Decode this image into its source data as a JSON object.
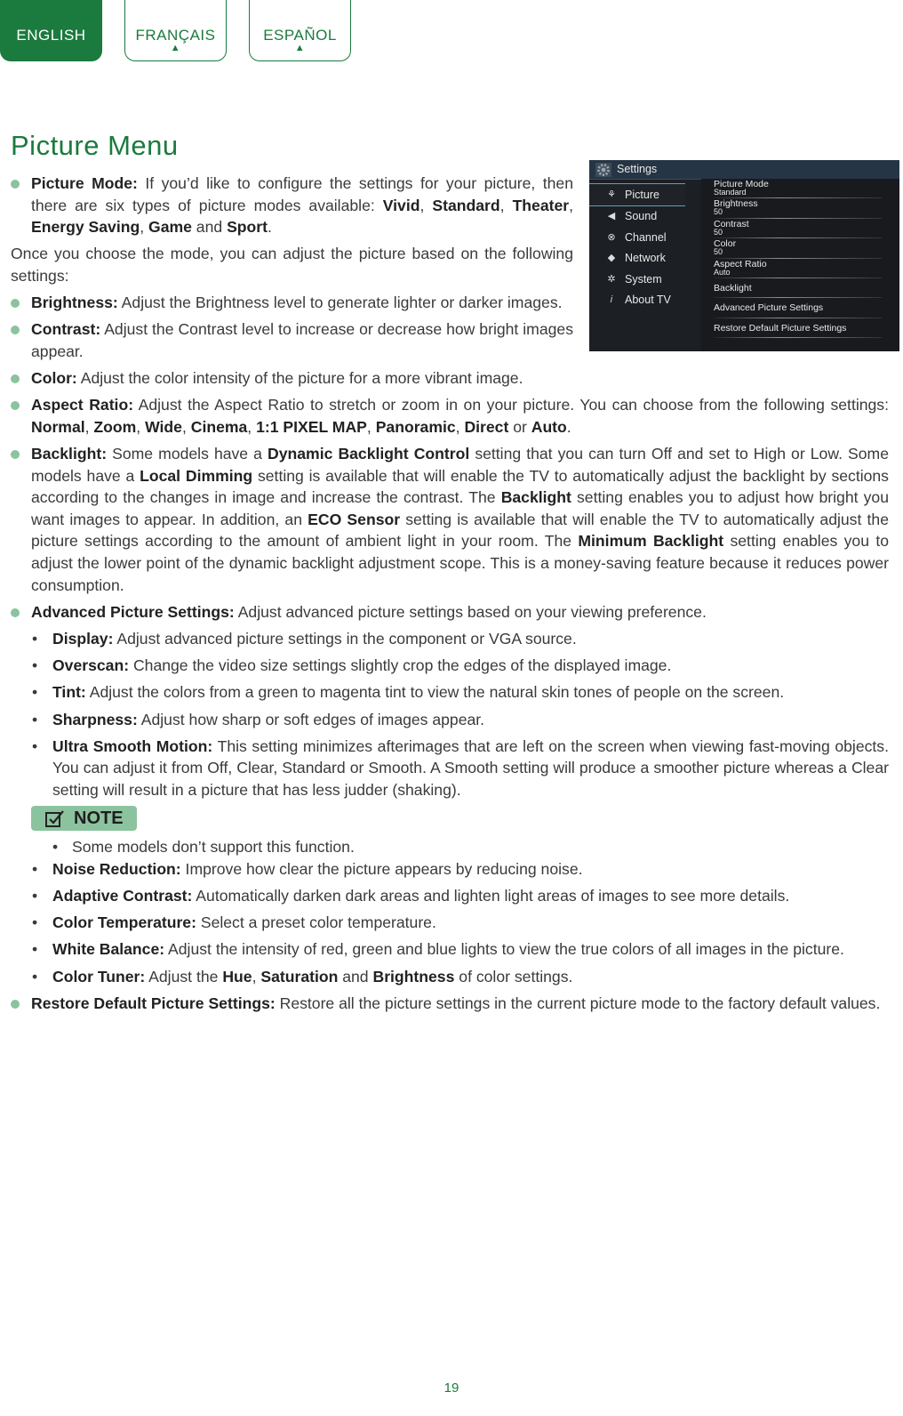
{
  "tabs": [
    {
      "label": "ENGLISH",
      "active": true
    },
    {
      "label": "FRANÇAIS",
      "marker": "▲"
    },
    {
      "label": "ESPAÑOL",
      "marker": "▲"
    }
  ],
  "title": "Picture Menu",
  "colors": {
    "brand": "#1b7a3e",
    "bullet": "#8cc39f",
    "note_bg": "#8cc39f"
  },
  "tv_screen": {
    "header": "Settings",
    "header_icon": "gear-icon",
    "menu": [
      {
        "label": "Picture",
        "icon": "picture-icon",
        "selected": true
      },
      {
        "label": "Sound",
        "icon": "speaker-icon"
      },
      {
        "label": "Channel",
        "icon": "satellite-icon"
      },
      {
        "label": "Network",
        "icon": "network-icon"
      },
      {
        "label": "System",
        "icon": "cog-icon"
      },
      {
        "label": "About TV",
        "icon": "info-icon"
      }
    ],
    "settings": [
      {
        "label": "Picture Mode",
        "value": "Standard"
      },
      {
        "label": "Brightness",
        "value": "50"
      },
      {
        "label": "Contrast",
        "value": "50"
      },
      {
        "label": "Color",
        "value": "50"
      },
      {
        "label": "Aspect Ratio",
        "value": "Auto"
      },
      {
        "label": "Backlight"
      },
      {
        "label": "Advanced Picture Settings"
      },
      {
        "label": "Restore Default Picture Settings"
      }
    ]
  },
  "paragraphs": [
    {
      "type": "circle",
      "segments": [
        [
          "Picture Mode:",
          1
        ],
        [
          " If you’d like to configure the settings for your picture, then there are six types of picture modes available: ",
          0
        ],
        [
          "Vivid",
          1
        ],
        [
          ", ",
          0
        ],
        [
          "Standard",
          1
        ],
        [
          ", ",
          0
        ],
        [
          "Theater",
          1
        ],
        [
          ", ",
          0
        ],
        [
          "Energy Saving",
          1
        ],
        [
          ", ",
          0
        ],
        [
          "Game",
          1
        ],
        [
          " and ",
          0
        ],
        [
          "Sport",
          1
        ],
        [
          ".",
          0
        ]
      ]
    },
    {
      "type": "plain",
      "segments": [
        [
          "Once you choose the mode, you can adjust the picture based on the following settings:",
          0
        ]
      ]
    },
    {
      "type": "circle",
      "segments": [
        [
          "Brightness:",
          1
        ],
        [
          " Adjust the Brightness level to generate lighter or darker images.",
          0
        ]
      ]
    },
    {
      "type": "circle",
      "segments": [
        [
          "Contrast:",
          1
        ],
        [
          " Adjust the Contrast level to increase or decrease how bright images appear.",
          0
        ]
      ]
    },
    {
      "type": "circle",
      "segments": [
        [
          "Color:",
          1
        ],
        [
          " Adjust the color intensity of the picture for a more vibrant image.",
          0
        ]
      ]
    },
    {
      "type": "circle",
      "segments": [
        [
          "Aspect Ratio:",
          1
        ],
        [
          " Adjust the Aspect Ratio to stretch or zoom in on your picture. You can choose from the following settings: ",
          0
        ],
        [
          "Normal",
          1
        ],
        [
          ", ",
          0
        ],
        [
          "Zoom",
          1
        ],
        [
          ", ",
          0
        ],
        [
          "Wide",
          1
        ],
        [
          ", ",
          0
        ],
        [
          "Cinema",
          1
        ],
        [
          ", ",
          0
        ],
        [
          "1:1 PIXEL MAP",
          1
        ],
        [
          ", ",
          0
        ],
        [
          "Panoramic",
          1
        ],
        [
          ", ",
          0
        ],
        [
          "Direct",
          1
        ],
        [
          " or ",
          0
        ],
        [
          "Auto",
          1
        ],
        [
          ".",
          0
        ]
      ]
    },
    {
      "type": "circle",
      "segments": [
        [
          "Backlight:",
          1
        ],
        [
          " Some models have a ",
          0
        ],
        [
          "Dynamic Backlight Control",
          1
        ],
        [
          " setting that you can turn Off and set to High or Low. Some models have a ",
          0
        ],
        [
          "Local Dimming",
          1
        ],
        [
          " setting is available that will enable the TV to automatically adjust the backlight by sections according to the changes in image and increase the contrast. The ",
          0
        ],
        [
          "Backlight",
          1
        ],
        [
          " setting enables you to adjust how bright you want images to appear. In addition, an ",
          0
        ],
        [
          "ECO Sensor",
          1
        ],
        [
          " setting is available that will enable the TV to automatically adjust the picture settings according to the amount of ambient light in your room. The ",
          0
        ],
        [
          "Minimum Backlight",
          1
        ],
        [
          " setting enables you to adjust the lower point of the dynamic backlight adjustment scope. This is a money-saving feature because it reduces power consumption.",
          0
        ]
      ]
    },
    {
      "type": "circle",
      "segments": [
        [
          "Advanced Picture Settings:",
          1
        ],
        [
          " Adjust advanced picture settings based on your viewing preference.",
          0
        ]
      ]
    },
    {
      "type": "dot",
      "segments": [
        [
          "Display:",
          1
        ],
        [
          " Adjust advanced picture settings in the component or VGA source.",
          0
        ]
      ]
    },
    {
      "type": "dot",
      "segments": [
        [
          "Overscan:",
          1
        ],
        [
          " Change the video size settings slightly crop the edges of the displayed image.",
          0
        ]
      ]
    },
    {
      "type": "dot",
      "segments": [
        [
          "Tint:",
          1
        ],
        [
          " Adjust the colors from a green to magenta tint to view the natural skin tones of people on the screen.",
          0
        ]
      ]
    },
    {
      "type": "dot",
      "segments": [
        [
          "Sharpness:",
          1
        ],
        [
          " Adjust how sharp or soft edges of images appear.",
          0
        ]
      ]
    },
    {
      "type": "dot",
      "segments": [
        [
          "Ultra Smooth Motion:",
          1
        ],
        [
          " This setting minimizes afterimages that are left on the screen when viewing fast-moving objects. You can adjust it from Off, Clear, Standard or Smooth. A Smooth setting will produce a smoother picture whereas a Clear setting will result in a picture that has less judder (shaking).",
          0
        ]
      ]
    },
    {
      "type": "note",
      "label": "NOTE"
    },
    {
      "type": "subdot",
      "segments": [
        [
          "Some models don’t support this function.",
          0
        ]
      ]
    },
    {
      "type": "dot",
      "segments": [
        [
          "Noise Reduction:",
          1
        ],
        [
          " Improve how clear the picture appears by reducing noise.",
          0
        ]
      ]
    },
    {
      "type": "dot",
      "segments": [
        [
          "Adaptive Contrast:",
          1
        ],
        [
          " Automatically darken dark areas and lighten light areas of images to see more details.",
          0
        ]
      ]
    },
    {
      "type": "dot",
      "segments": [
        [
          "Color Temperature:",
          1
        ],
        [
          " Select a preset color temperature.",
          0
        ]
      ]
    },
    {
      "type": "dot",
      "segments": [
        [
          "White Balance:",
          1
        ],
        [
          " Adjust the intensity of red, green and blue lights to view the true colors of all images in the picture.",
          0
        ]
      ]
    },
    {
      "type": "dot",
      "segments": [
        [
          "Color Tuner:",
          1
        ],
        [
          " Adjust the ",
          0
        ],
        [
          "Hue",
          1
        ],
        [
          ", ",
          0
        ],
        [
          "Saturation",
          1
        ],
        [
          " and ",
          0
        ],
        [
          "Brightness",
          1
        ],
        [
          " of color settings.",
          0
        ]
      ]
    },
    {
      "type": "circle",
      "segments": [
        [
          "Restore Default Picture Settings:",
          1
        ],
        [
          " Restore all the picture settings in the current picture mode to the factory default values.",
          0
        ]
      ]
    }
  ],
  "page_number": "19"
}
